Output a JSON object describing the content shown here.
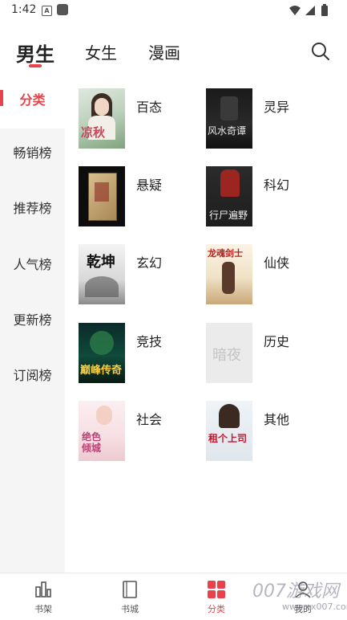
{
  "status_bar": {
    "time": "1:42",
    "notif_letter": "A"
  },
  "top_tabs": {
    "male": "男生",
    "female": "女生",
    "comic": "漫画"
  },
  "sidebar": {
    "items": [
      {
        "label": "分类"
      },
      {
        "label": "畅销榜"
      },
      {
        "label": "推荐榜"
      },
      {
        "label": "人气榜"
      },
      {
        "label": "更新榜"
      },
      {
        "label": "订阅榜"
      }
    ]
  },
  "categories": [
    {
      "label": "百态",
      "cover_text": "凉秋"
    },
    {
      "label": "灵异",
      "cover_text": "风水奇谭"
    },
    {
      "label": "悬疑",
      "cover_text": ""
    },
    {
      "label": "科幻",
      "cover_text": "行尸遍野"
    },
    {
      "label": "玄幻",
      "cover_text": "乾坤"
    },
    {
      "label": "仙侠",
      "cover_text": "龙魂剑士"
    },
    {
      "label": "竞技",
      "cover_text": "巅峰传奇"
    },
    {
      "label": "历史",
      "cover_text": "暗夜"
    },
    {
      "label": "社会",
      "cover_text": "绝色倾城"
    },
    {
      "label": "其他",
      "cover_text": "租个上司"
    }
  ],
  "bottom_nav": {
    "items": [
      {
        "label": "书架"
      },
      {
        "label": "书城"
      },
      {
        "label": "分类"
      },
      {
        "label": "我的"
      }
    ]
  },
  "watermark": {
    "main": "007游戏网",
    "sub": "www.yx007.com"
  },
  "colors": {
    "accent": "#e8424a",
    "sidebar_bg": "#f5f5f5"
  }
}
